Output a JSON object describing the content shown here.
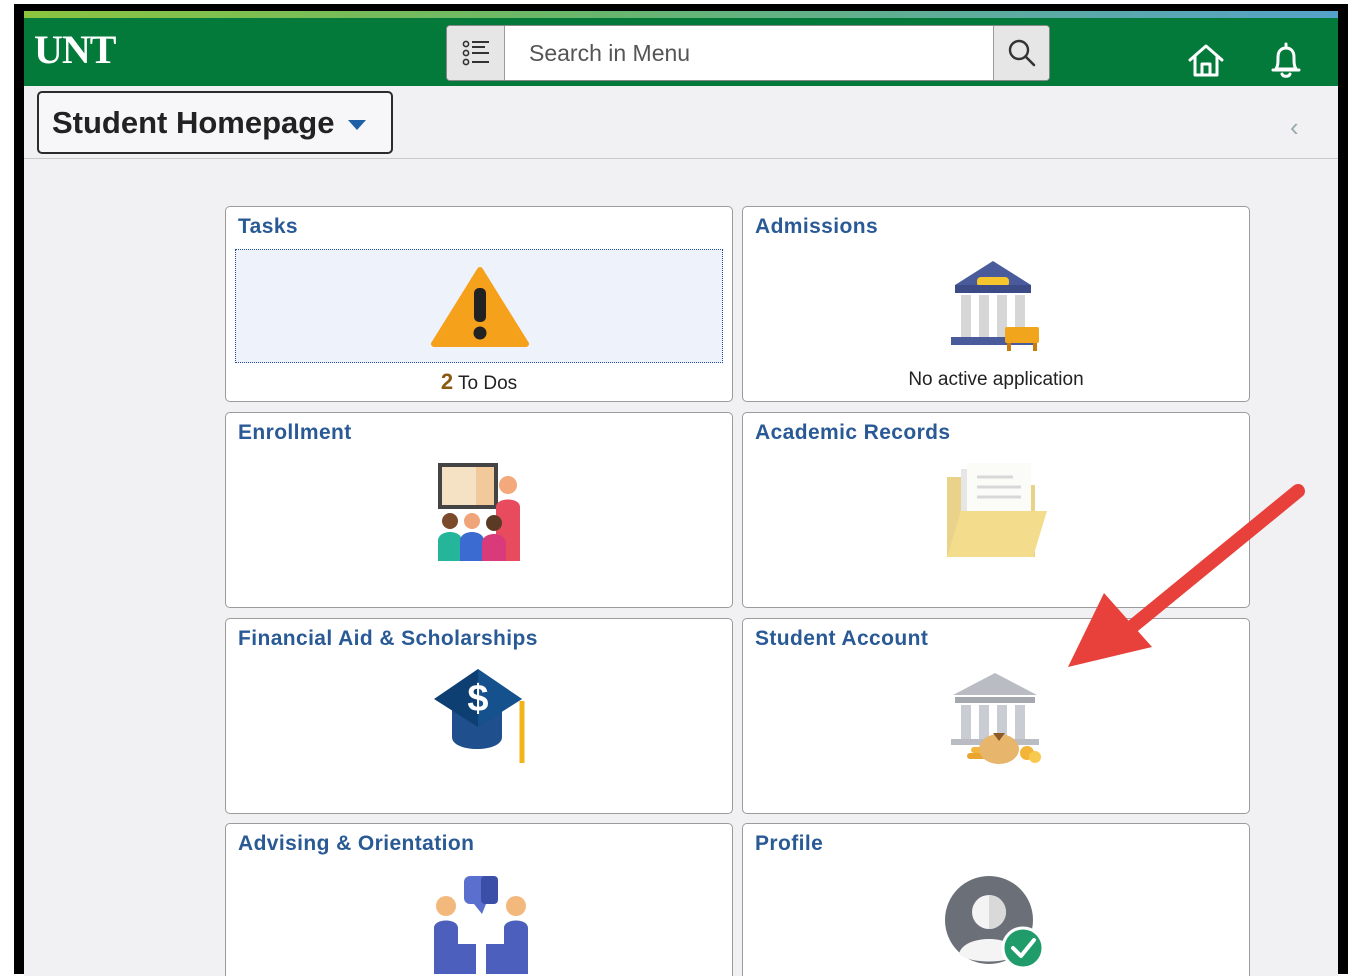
{
  "header": {
    "logo": "UNT",
    "search_placeholder": "Search in Menu",
    "icons": {
      "menu": "menu-list-icon",
      "search": "search-icon",
      "home": "home-icon",
      "notifications": "bell-icon"
    }
  },
  "subheader": {
    "page_title": "Student Homepage"
  },
  "tiles": [
    {
      "title": "Tasks",
      "count": "2",
      "caption": "To Dos",
      "icon": "warning-icon"
    },
    {
      "title": "Admissions",
      "caption": "No active application",
      "icon": "bank-building-icon"
    },
    {
      "title": "Enrollment",
      "icon": "classroom-icon"
    },
    {
      "title": "Academic Records",
      "icon": "folder-icon"
    },
    {
      "title": "Financial Aid & Scholarships",
      "icon": "graduation-cap-dollar-icon"
    },
    {
      "title": "Student Account",
      "icon": "bank-money-bag-icon"
    },
    {
      "title": "Advising & Orientation",
      "icon": "advisors-chat-icon"
    },
    {
      "title": "Profile",
      "icon": "user-checked-icon"
    }
  ],
  "colors": {
    "header_green": "#037a3a",
    "tile_title_blue": "#2a5a96",
    "annotation_arrow": "#e8403a"
  }
}
